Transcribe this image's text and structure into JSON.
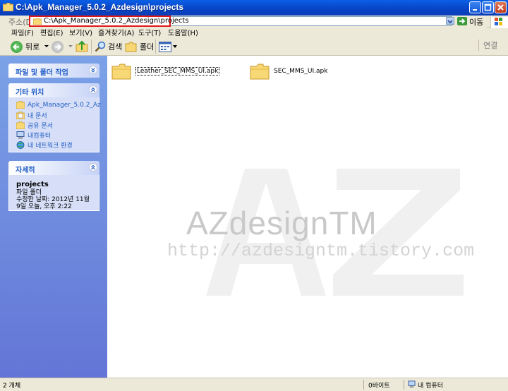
{
  "window": {
    "title": "C:\\Apk_Manager_5.0.2_Azdesign\\projects"
  },
  "address": {
    "label": "주소(D)",
    "path": "C:\\Apk_Manager_5.0.2_Azdesign\\projects",
    "go_label": "이동"
  },
  "menu": {
    "items": [
      "파일(F)",
      "편집(E)",
      "보기(V)",
      "즐겨찾기(A)",
      "도구(T)",
      "도움말(H)"
    ]
  },
  "toolbar": {
    "back": "뒤로",
    "search": "검색",
    "folders": "폴더",
    "connect": "연결"
  },
  "tasks_panel": {
    "title": "파일 및 폴더 작업"
  },
  "other_places": {
    "title": "기타 위치",
    "items": [
      "Apk_Manager_5.0.2_Az",
      "내 문서",
      "공유 문서",
      "내컴퓨터",
      "내 네트워크 환경"
    ]
  },
  "details": {
    "title": "자세히",
    "name": "projects",
    "type": "파일 폴더",
    "modified": "수정한 날짜: 2012년 11월 9일 오늘, 오후 2:22"
  },
  "files": [
    {
      "name": "Leather_SEC_MMS_UI.apk",
      "selected": true
    },
    {
      "name": "SEC_MMS_UI.apk",
      "selected": false
    }
  ],
  "watermark": {
    "letters": "AZ",
    "title": "AZdesignTM",
    "url": "http://azdesigntm.tistory.com"
  },
  "status": {
    "count": "2 개체",
    "size": "0바이트",
    "location": "내 컴퓨터"
  }
}
